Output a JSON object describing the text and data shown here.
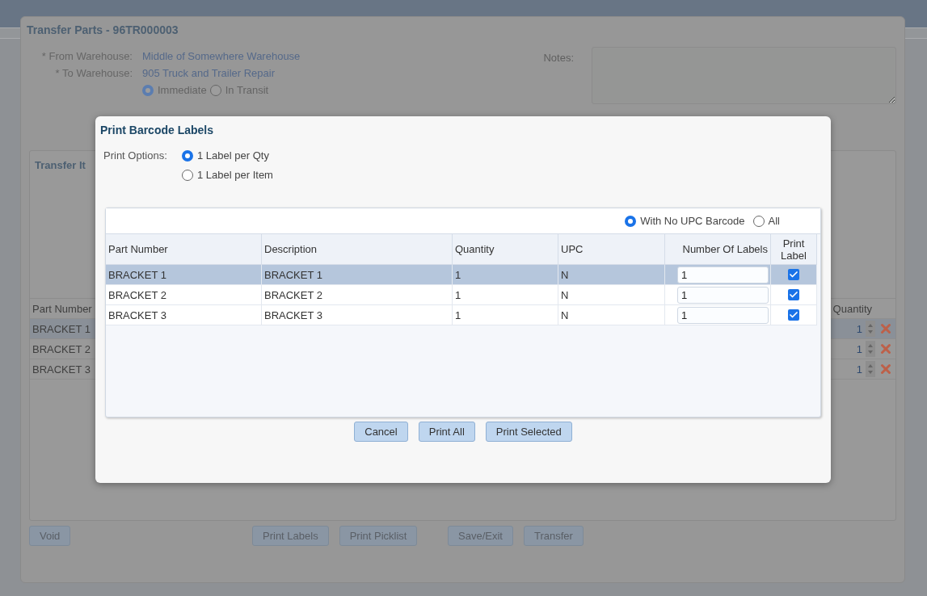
{
  "transfer_dialog": {
    "title": "Transfer Parts - 96TR000003",
    "fields": [
      {
        "label": "* From Warehouse:",
        "value": "Middle of Somewhere Warehouse"
      },
      {
        "label": "* To Warehouse:",
        "value": "905 Truck and Trailer Repair"
      }
    ],
    "mode_options": [
      {
        "label": "Immediate",
        "selected": true
      },
      {
        "label": "In Transit",
        "selected": false
      }
    ],
    "notes_label": "Notes:",
    "items_panel": {
      "title": "Transfer It",
      "columns": [
        "Part Number",
        "Quantity"
      ],
      "rows": [
        {
          "part_number": "BRACKET 1",
          "quantity": "1",
          "selected": true
        },
        {
          "part_number": "BRACKET 2",
          "quantity": "1",
          "selected": false
        },
        {
          "part_number": "BRACKET 3",
          "quantity": "1",
          "selected": false
        }
      ]
    },
    "button_groups": [
      [
        "Void"
      ],
      [
        "Print Labels",
        "Print Picklist"
      ],
      [
        "Save/Exit",
        "Transfer"
      ]
    ]
  },
  "print_dialog": {
    "title": "Print Barcode Labels",
    "options_label": "Print Options:",
    "print_options": [
      {
        "label": "1 Label per Qty",
        "selected": true
      },
      {
        "label": "1 Label per Item",
        "selected": false
      }
    ],
    "filters": [
      {
        "label": "With No UPC Barcode",
        "selected": true
      },
      {
        "label": "All",
        "selected": false
      }
    ],
    "columns": [
      "Part Number",
      "Description",
      "Quantity",
      "UPC",
      "Number Of Labels",
      "Print Label"
    ],
    "rows": [
      {
        "part_number": "BRACKET 1",
        "description": "BRACKET 1",
        "quantity": "1",
        "upc": "N",
        "labels": "1",
        "print": true,
        "selected": true
      },
      {
        "part_number": "BRACKET 2",
        "description": "BRACKET 2",
        "quantity": "1",
        "upc": "N",
        "labels": "1",
        "print": true,
        "selected": false
      },
      {
        "part_number": "BRACKET 3",
        "description": "BRACKET 3",
        "quantity": "1",
        "upc": "N",
        "labels": "1",
        "print": true,
        "selected": false
      }
    ],
    "buttons": [
      "Cancel",
      "Print All",
      "Print Selected"
    ]
  }
}
